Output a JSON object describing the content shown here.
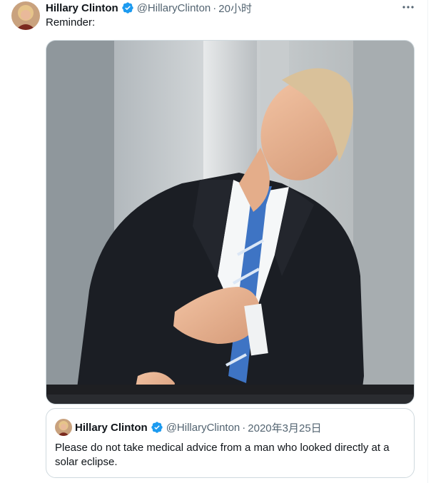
{
  "tweet": {
    "author_name": "Hillary Clinton",
    "author_handle": "@HillaryClinton",
    "separator": "·",
    "time": "20小时",
    "text": "Reminder:",
    "more_icon": "more-horizontal-icon",
    "verified_icon": "verified-badge-icon"
  },
  "quoted_tweet": {
    "author_name": "Hillary Clinton",
    "author_handle": "@HillaryClinton",
    "separator": "·",
    "date": "2020年3月25日",
    "text": "Please do not take medical advice from a man who looked directly at a solar eclipse."
  },
  "colors": {
    "verified": "#1d9bf0",
    "secondary_text": "#536471",
    "border": "#cfd9de"
  }
}
